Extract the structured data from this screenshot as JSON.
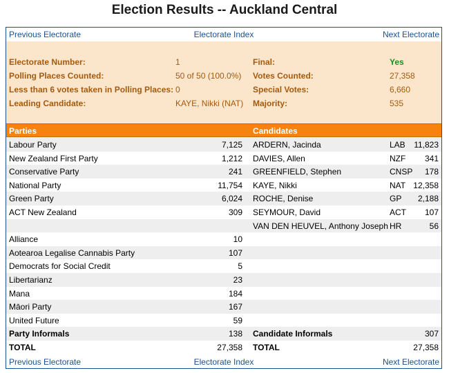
{
  "title": "Election Results -- Auckland Central",
  "nav": {
    "previous": "Previous Electorate",
    "index": "Electorate Index",
    "next": "Next Electorate"
  },
  "summary": {
    "electorate_number_label": "Electorate Number:",
    "electorate_number": "1",
    "polling_places_label": "Polling Places Counted:",
    "polling_places": "50 of 50 (100.0%)",
    "less_than_label": "Less than 6 votes taken in Polling Places:",
    "less_than": "0",
    "leading_label": "Leading Candidate:",
    "leading": "KAYE, Nikki (NAT)",
    "final_label": "Final:",
    "final": "Yes",
    "votes_counted_label": "Votes Counted:",
    "votes_counted": "27,358",
    "special_votes_label": "Special Votes:",
    "special_votes": "6,660",
    "majority_label": "Majority:",
    "majority": "535"
  },
  "headers": {
    "parties": "Parties",
    "candidates": "Candidates"
  },
  "rows": [
    {
      "party": "Labour Party",
      "party_votes": "7,125",
      "candidate": "ARDERN, Jacinda",
      "cand_party": "LAB",
      "cand_votes": "11,823"
    },
    {
      "party": "New Zealand First Party",
      "party_votes": "1,212",
      "candidate": "DAVIES, Allen",
      "cand_party": "NZF",
      "cand_votes": "341"
    },
    {
      "party": "Conservative Party",
      "party_votes": "241",
      "candidate": "GREENFIELD, Stephen",
      "cand_party": "CNSP",
      "cand_votes": "178"
    },
    {
      "party": "National Party",
      "party_votes": "11,754",
      "candidate": "KAYE, Nikki",
      "cand_party": "NAT",
      "cand_votes": "12,358"
    },
    {
      "party": "Green Party",
      "party_votes": "6,024",
      "candidate": "ROCHE, Denise",
      "cand_party": "GP",
      "cand_votes": "2,188"
    },
    {
      "party": "ACT New Zealand",
      "party_votes": "309",
      "candidate": "SEYMOUR, David",
      "cand_party": "ACT",
      "cand_votes": "107"
    },
    {
      "party": "",
      "party_votes": "",
      "candidate": "VAN DEN HEUVEL, Anthony Joseph",
      "cand_party": "HR",
      "cand_votes": "56"
    },
    {
      "party": "Alliance",
      "party_votes": "10",
      "candidate": "",
      "cand_party": "",
      "cand_votes": ""
    },
    {
      "party": "Aotearoa Legalise Cannabis Party",
      "party_votes": "107",
      "candidate": "",
      "cand_party": "",
      "cand_votes": ""
    },
    {
      "party": "Democrats for Social Credit",
      "party_votes": "5",
      "candidate": "",
      "cand_party": "",
      "cand_votes": ""
    },
    {
      "party": "Libertarianz",
      "party_votes": "23",
      "candidate": "",
      "cand_party": "",
      "cand_votes": ""
    },
    {
      "party": "Mana",
      "party_votes": "184",
      "candidate": "",
      "cand_party": "",
      "cand_votes": ""
    },
    {
      "party": "Māori Party",
      "party_votes": "167",
      "candidate": "",
      "cand_party": "",
      "cand_votes": ""
    },
    {
      "party": "United Future",
      "party_votes": "59",
      "candidate": "",
      "cand_party": "",
      "cand_votes": ""
    }
  ],
  "totals": {
    "party_informals_label": "Party Informals",
    "party_informals": "138",
    "candidate_informals_label": "Candidate Informals",
    "candidate_informals": "307",
    "total_label": "TOTAL",
    "party_total": "27,358",
    "candidate_total_label": "TOTAL",
    "candidate_total": "27,358"
  }
}
